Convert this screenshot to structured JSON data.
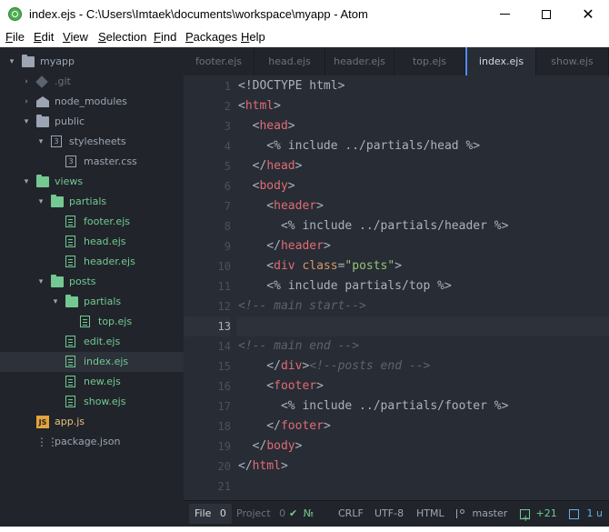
{
  "window": {
    "title": "index.ejs - C:\\Users\\Imtaek\\documents\\workspace\\myapp - Atom",
    "minimize_label": "",
    "close_glyph": "✕"
  },
  "menu": {
    "items": [
      "File",
      "Edit",
      "View",
      "Selection",
      "Find",
      "Packages",
      "Help"
    ]
  },
  "tree": {
    "items": [
      {
        "label": "myapp",
        "arrow": "▾",
        "icon": "repo-icon",
        "color": "muted"
      },
      {
        "label": ".git",
        "arrow": "›",
        "icon": "git-icon",
        "color": "dim"
      },
      {
        "label": "node_modules",
        "arrow": "›",
        "icon": "folder-icon",
        "color": "muted"
      },
      {
        "label": "public",
        "arrow": "▾",
        "icon": "folder-icon",
        "color": "muted"
      },
      {
        "label": "stylesheets",
        "arrow": "▾",
        "icon": "css-folder-icon",
        "color": "muted"
      },
      {
        "label": "master.css",
        "arrow": "",
        "icon": "css-file-icon",
        "color": "muted"
      },
      {
        "label": "views",
        "arrow": "▾",
        "icon": "folder-icon",
        "color": "green"
      },
      {
        "label": "partials",
        "arrow": "▾",
        "icon": "folder-icon",
        "color": "green"
      },
      {
        "label": "footer.ejs",
        "arrow": "",
        "icon": "file-icon",
        "color": "green"
      },
      {
        "label": "head.ejs",
        "arrow": "",
        "icon": "file-icon",
        "color": "green"
      },
      {
        "label": "header.ejs",
        "arrow": "",
        "icon": "file-icon",
        "color": "green"
      },
      {
        "label": "posts",
        "arrow": "▾",
        "icon": "folder-icon",
        "color": "green"
      },
      {
        "label": "partials",
        "arrow": "▾",
        "icon": "folder-icon",
        "color": "green"
      },
      {
        "label": "top.ejs",
        "arrow": "",
        "icon": "file-icon",
        "color": "green"
      },
      {
        "label": "edit.ejs",
        "arrow": "",
        "icon": "file-icon",
        "color": "green"
      },
      {
        "label": "index.ejs",
        "arrow": "",
        "icon": "file-icon",
        "color": "green",
        "selected": true
      },
      {
        "label": "new.ejs",
        "arrow": "",
        "icon": "file-icon",
        "color": "green"
      },
      {
        "label": "show.ejs",
        "arrow": "",
        "icon": "file-icon",
        "color": "green"
      },
      {
        "label": "app.js",
        "arrow": "",
        "icon": "js-file-icon",
        "color": "gold"
      },
      {
        "label": "package.json",
        "arrow": "",
        "icon": "package-icon",
        "color": "muted"
      }
    ]
  },
  "tabs": [
    {
      "label": "footer.ejs",
      "active": false
    },
    {
      "label": "head.ejs",
      "active": false
    },
    {
      "label": "header.ejs",
      "active": false
    },
    {
      "label": "top.ejs",
      "active": false
    },
    {
      "label": "index.ejs",
      "active": true
    },
    {
      "label": "show.ejs",
      "active": false
    }
  ],
  "editor": {
    "current_line": 13,
    "lines": [
      {
        "n": "1",
        "html": "<!DOCTYPE html>",
        "parts": [
          [
            "",
            "<!DOCTYPE html>"
          ]
        ]
      },
      {
        "n": "2",
        "parts": [
          [
            "",
            "<"
          ],
          [
            "tag",
            "html"
          ],
          [
            "",
            ">"
          ]
        ]
      },
      {
        "n": "3",
        "parts": [
          [
            "",
            "  <"
          ],
          [
            "tag",
            "head"
          ],
          [
            "",
            ">"
          ]
        ]
      },
      {
        "n": "4",
        "parts": [
          [
            "",
            "    <% include ../partials/head %>"
          ]
        ]
      },
      {
        "n": "5",
        "parts": [
          [
            "",
            "  </"
          ],
          [
            "tag",
            "head"
          ],
          [
            "",
            ">"
          ]
        ]
      },
      {
        "n": "6",
        "parts": [
          [
            "",
            "  <"
          ],
          [
            "tag",
            "body"
          ],
          [
            "",
            ">"
          ]
        ]
      },
      {
        "n": "7",
        "parts": [
          [
            "",
            "    <"
          ],
          [
            "tag",
            "header"
          ],
          [
            "",
            ">"
          ]
        ]
      },
      {
        "n": "8",
        "parts": [
          [
            "",
            "      <% include ../partials/header %>"
          ]
        ]
      },
      {
        "n": "9",
        "parts": [
          [
            "",
            "    </"
          ],
          [
            "tag",
            "header"
          ],
          [
            "",
            ">"
          ]
        ]
      },
      {
        "n": "10",
        "parts": [
          [
            "",
            "    <"
          ],
          [
            "tag",
            "div"
          ],
          [
            "",
            " "
          ],
          [
            "attr",
            "class"
          ],
          [
            "",
            "="
          ],
          [
            "str",
            "\"posts\""
          ],
          [
            "",
            ">"
          ]
        ]
      },
      {
        "n": "11",
        "parts": [
          [
            "",
            "    <% include partials/top %>"
          ]
        ]
      },
      {
        "n": "12",
        "parts": [
          [
            "cmt",
            "<!-- main start-->"
          ]
        ]
      },
      {
        "n": "13",
        "parts": [
          [
            "",
            ""
          ]
        ]
      },
      {
        "n": "14",
        "parts": [
          [
            "cmt",
            "<!-- main end -->"
          ]
        ]
      },
      {
        "n": "15",
        "parts": [
          [
            "",
            "    </"
          ],
          [
            "tag",
            "div"
          ],
          [
            "",
            ">"
          ],
          [
            "cmt",
            "<!--posts end -->"
          ]
        ]
      },
      {
        "n": "16",
        "parts": [
          [
            "",
            "    <"
          ],
          [
            "tag",
            "footer"
          ],
          [
            "",
            ">"
          ]
        ]
      },
      {
        "n": "17",
        "parts": [
          [
            "",
            "      <% include ../partials/footer %>"
          ]
        ]
      },
      {
        "n": "18",
        "parts": [
          [
            "",
            "    </"
          ],
          [
            "tag",
            "footer"
          ],
          [
            "",
            ">"
          ]
        ]
      },
      {
        "n": "19",
        "parts": [
          [
            "",
            "  </"
          ],
          [
            "tag",
            "body"
          ],
          [
            "",
            ">"
          ]
        ]
      },
      {
        "n": "20",
        "parts": [
          [
            "",
            "</"
          ],
          [
            "tag",
            "html"
          ],
          [
            "",
            ">"
          ]
        ]
      },
      {
        "n": "21",
        "parts": [
          [
            "",
            ""
          ]
        ]
      }
    ]
  },
  "status": {
    "file_tab": "File",
    "file_count": "0",
    "project_tab": "Project",
    "project_count": "0",
    "check_glyph": "✔",
    "check_label": "№",
    "line_ending": "CRLF",
    "encoding": "UTF-8",
    "grammar": "HTML",
    "branch": "master",
    "diff": "+21",
    "updates": "1 u"
  },
  "colors": {
    "background": "#282c34",
    "sidebar": "#21252b",
    "tag": "#e06c75",
    "attribute": "#d19a66",
    "string": "#98c379",
    "comment": "#5c6370",
    "vcs_added": "#73c991",
    "accent": "#528bff",
    "js_icon": "#e5a33c"
  }
}
